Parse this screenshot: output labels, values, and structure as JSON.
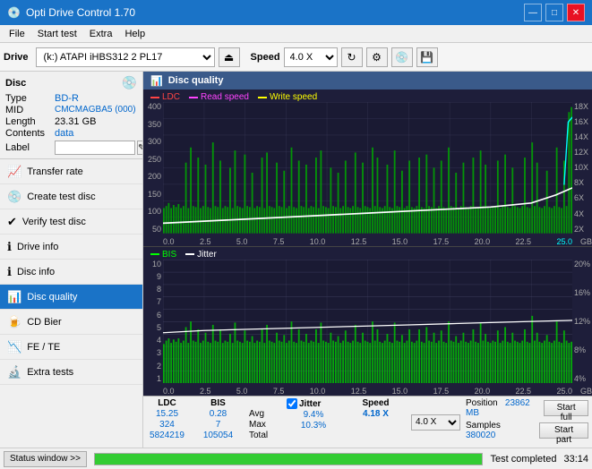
{
  "titlebar": {
    "title": "Opti Drive Control 1.70",
    "icon": "💿",
    "minimize_label": "—",
    "maximize_label": "□",
    "close_label": "✕"
  },
  "menubar": {
    "items": [
      "File",
      "Start test",
      "Extra",
      "Help"
    ]
  },
  "toolbar": {
    "drive_label": "Drive",
    "drive_value": "(k:) ATAPI iHBS312  2 PL17",
    "speed_label": "Speed",
    "speed_value": "4.0 X"
  },
  "disc": {
    "title": "Disc",
    "type_label": "Type",
    "type_value": "BD-R",
    "mid_label": "MID",
    "mid_value": "CMCMAGBA5 (000)",
    "length_label": "Length",
    "length_value": "23.31 GB",
    "contents_label": "Contents",
    "contents_value": "data",
    "label_label": "Label",
    "label_value": ""
  },
  "nav": {
    "items": [
      {
        "id": "transfer-rate",
        "label": "Transfer rate",
        "icon": "📈"
      },
      {
        "id": "create-test-disc",
        "label": "Create test disc",
        "icon": "💿"
      },
      {
        "id": "verify-test-disc",
        "label": "Verify test disc",
        "icon": "✔"
      },
      {
        "id": "drive-info",
        "label": "Drive info",
        "icon": "ℹ"
      },
      {
        "id": "disc-info",
        "label": "Disc info",
        "icon": "ℹ"
      },
      {
        "id": "disc-quality",
        "label": "Disc quality",
        "icon": "📊",
        "active": true
      },
      {
        "id": "cd-bier",
        "label": "CD Bier",
        "icon": "🍺"
      },
      {
        "id": "fe-te",
        "label": "FE / TE",
        "icon": "📉"
      },
      {
        "id": "extra-tests",
        "label": "Extra tests",
        "icon": "🔬"
      }
    ]
  },
  "content": {
    "title": "Disc quality",
    "chart1": {
      "legend": [
        {
          "id": "ldc",
          "label": "LDC",
          "color": "#ff4444"
        },
        {
          "id": "read-speed",
          "label": "Read speed",
          "color": "#ff44ff"
        },
        {
          "id": "write-speed",
          "label": "Write speed",
          "color": "#ffff00"
        }
      ],
      "y_labels_right": [
        "18X",
        "16X",
        "14X",
        "12X",
        "10X",
        "8X",
        "6X",
        "4X",
        "2X"
      ],
      "y_labels_left": [
        "400",
        "350",
        "300",
        "250",
        "200",
        "150",
        "100",
        "50"
      ],
      "x_labels": [
        "0.0",
        "2.5",
        "5.0",
        "7.5",
        "10.0",
        "12.5",
        "15.0",
        "17.5",
        "20.0",
        "22.5",
        "25.0"
      ],
      "x_unit": "GB"
    },
    "chart2": {
      "legend": [
        {
          "id": "bis",
          "label": "BIS",
          "color": "#00ff00"
        },
        {
          "id": "jitter",
          "label": "Jitter",
          "color": "#ffffff"
        }
      ],
      "y_labels_right": [
        "20%",
        "16%",
        "12%",
        "8%",
        "4%"
      ],
      "y_labels_left": [
        "10",
        "9",
        "8",
        "7",
        "6",
        "5",
        "4",
        "3",
        "2",
        "1"
      ],
      "x_labels": [
        "0.0",
        "2.5",
        "5.0",
        "7.5",
        "10.0",
        "12.5",
        "15.0",
        "17.5",
        "20.0",
        "22.5",
        "25.0"
      ],
      "x_unit": "GB"
    }
  },
  "stats": {
    "headers": [
      "LDC",
      "BIS",
      "",
      "Jitter",
      "Speed",
      ""
    ],
    "avg_label": "Avg",
    "avg_ldc": "15.25",
    "avg_bis": "0.28",
    "avg_jitter": "9.4%",
    "avg_speed": "4.18 X",
    "max_label": "Max",
    "max_ldc": "324",
    "max_bis": "7",
    "max_jitter": "10.3%",
    "position_label": "Position",
    "position_val": "23862 MB",
    "total_label": "Total",
    "total_ldc": "5824219",
    "total_bis": "105054",
    "samples_label": "Samples",
    "samples_val": "380020",
    "jitter_checked": true,
    "jitter_label": "Jitter",
    "speed_select": "4.0 X",
    "start_full_label": "Start full",
    "start_part_label": "Start part"
  },
  "statusbar": {
    "window_btn": "Status window >>",
    "progress": 100,
    "status_text": "Test completed",
    "time": "33:14"
  }
}
